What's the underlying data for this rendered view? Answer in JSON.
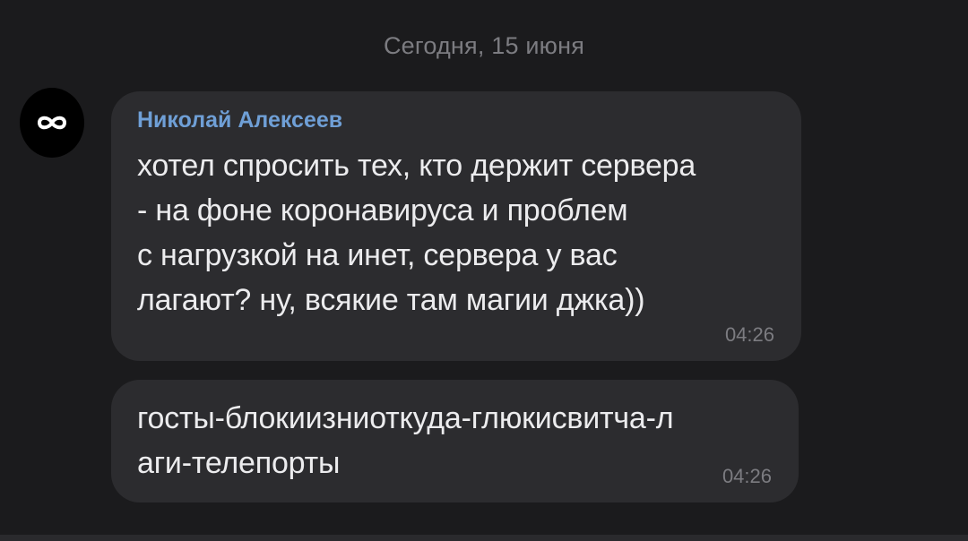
{
  "chat": {
    "date_separator": "Сегодня, 15 июня",
    "messages": [
      {
        "sender": "Николай Алексеев",
        "avatar_icon": "infinity-icon",
        "text": "хотел спросить тех, кто держит сервера\n- на фоне коронавируса и проблем\nс нагрузкой на инет, сервера у вас\nлагают? ну, всякие там магии джка))",
        "time": "04:26"
      },
      {
        "text": "госты-блокиизниоткуда-глюкисвитча-л\nаги-телепорты",
        "time": "04:26"
      }
    ]
  },
  "colors": {
    "background": "#1b1b1d",
    "bubble": "#2c2c2f",
    "sender_name": "#6f9fd6",
    "muted_text": "#7c7c81"
  }
}
